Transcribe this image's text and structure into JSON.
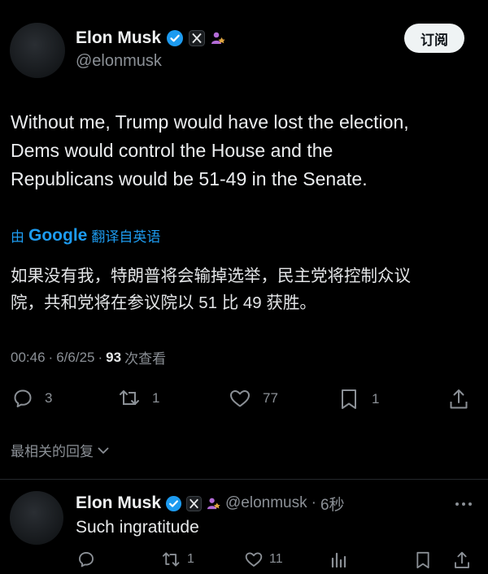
{
  "tweet": {
    "author_name": "Elon Musk",
    "handle": "@elonmusk",
    "subscribe_label": "订阅",
    "text_lines": [
      "Without me, Trump would have lost the election,",
      "Dems would control the House and the",
      "Republicans would be 51-49 in the Senate."
    ],
    "translation": {
      "by": "由",
      "google": "Google",
      "from": "翻译自英语"
    },
    "translated_lines": [
      "如果没有我，特朗普将会输掉选举，民主党将控制众议",
      "院，共和党将在参议院以 51 比 49 获胜。"
    ],
    "meta": {
      "time": "00:46",
      "sep1": "·",
      "date": "6/6/25",
      "sep2": "·",
      "views": "93",
      "views_label": "次查看"
    },
    "actions": {
      "replies": "3",
      "reposts": "1",
      "likes": "77",
      "bookmarks": "1"
    }
  },
  "replies_section": {
    "sort_label": "最相关的回复"
  },
  "reply": {
    "author_name": "Elon Musk",
    "handle": "@elonmusk",
    "sep": "·",
    "time": "6秒",
    "text": "Such ingratitude",
    "actions": {
      "reposts": "1",
      "likes": "11"
    }
  },
  "colors": {
    "background": "#000000",
    "text": "#e7e9ea",
    "muted": "#8b9096",
    "verified": "#1d9bf0",
    "translate_link": "#1d9bf0",
    "affiliate": "#b36bd6"
  }
}
